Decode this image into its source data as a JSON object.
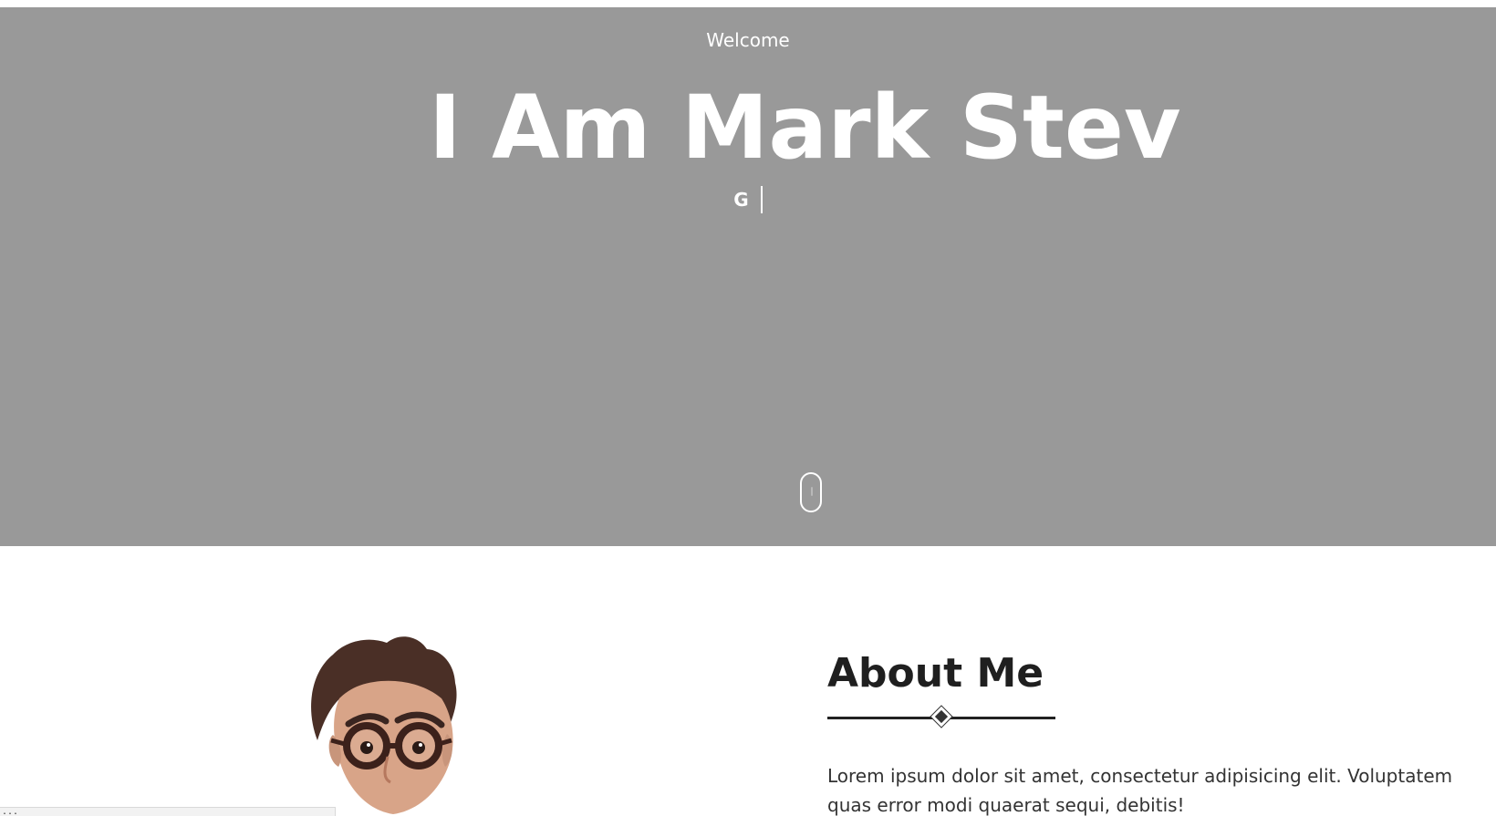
{
  "hero": {
    "kicker": "Welcome",
    "title": "I Am Mark Stev",
    "typed_text": "G",
    "scroll_icon": "mouse-scroll-icon",
    "background_color": "#999999"
  },
  "about": {
    "title": "About Me",
    "body": "Lorem ipsum dolor sit amet, consectetur adipisicing elit. Voluptatem quas error modi quaerat sequi, debitis!",
    "divider_icon": "diamond-divider-icon",
    "portrait": "profile-portrait"
  },
  "status_bar": {
    "text": "..."
  },
  "colors": {
    "hero_text": "#ffffff",
    "heading": "#1f1f1f",
    "body_text": "#333333"
  }
}
